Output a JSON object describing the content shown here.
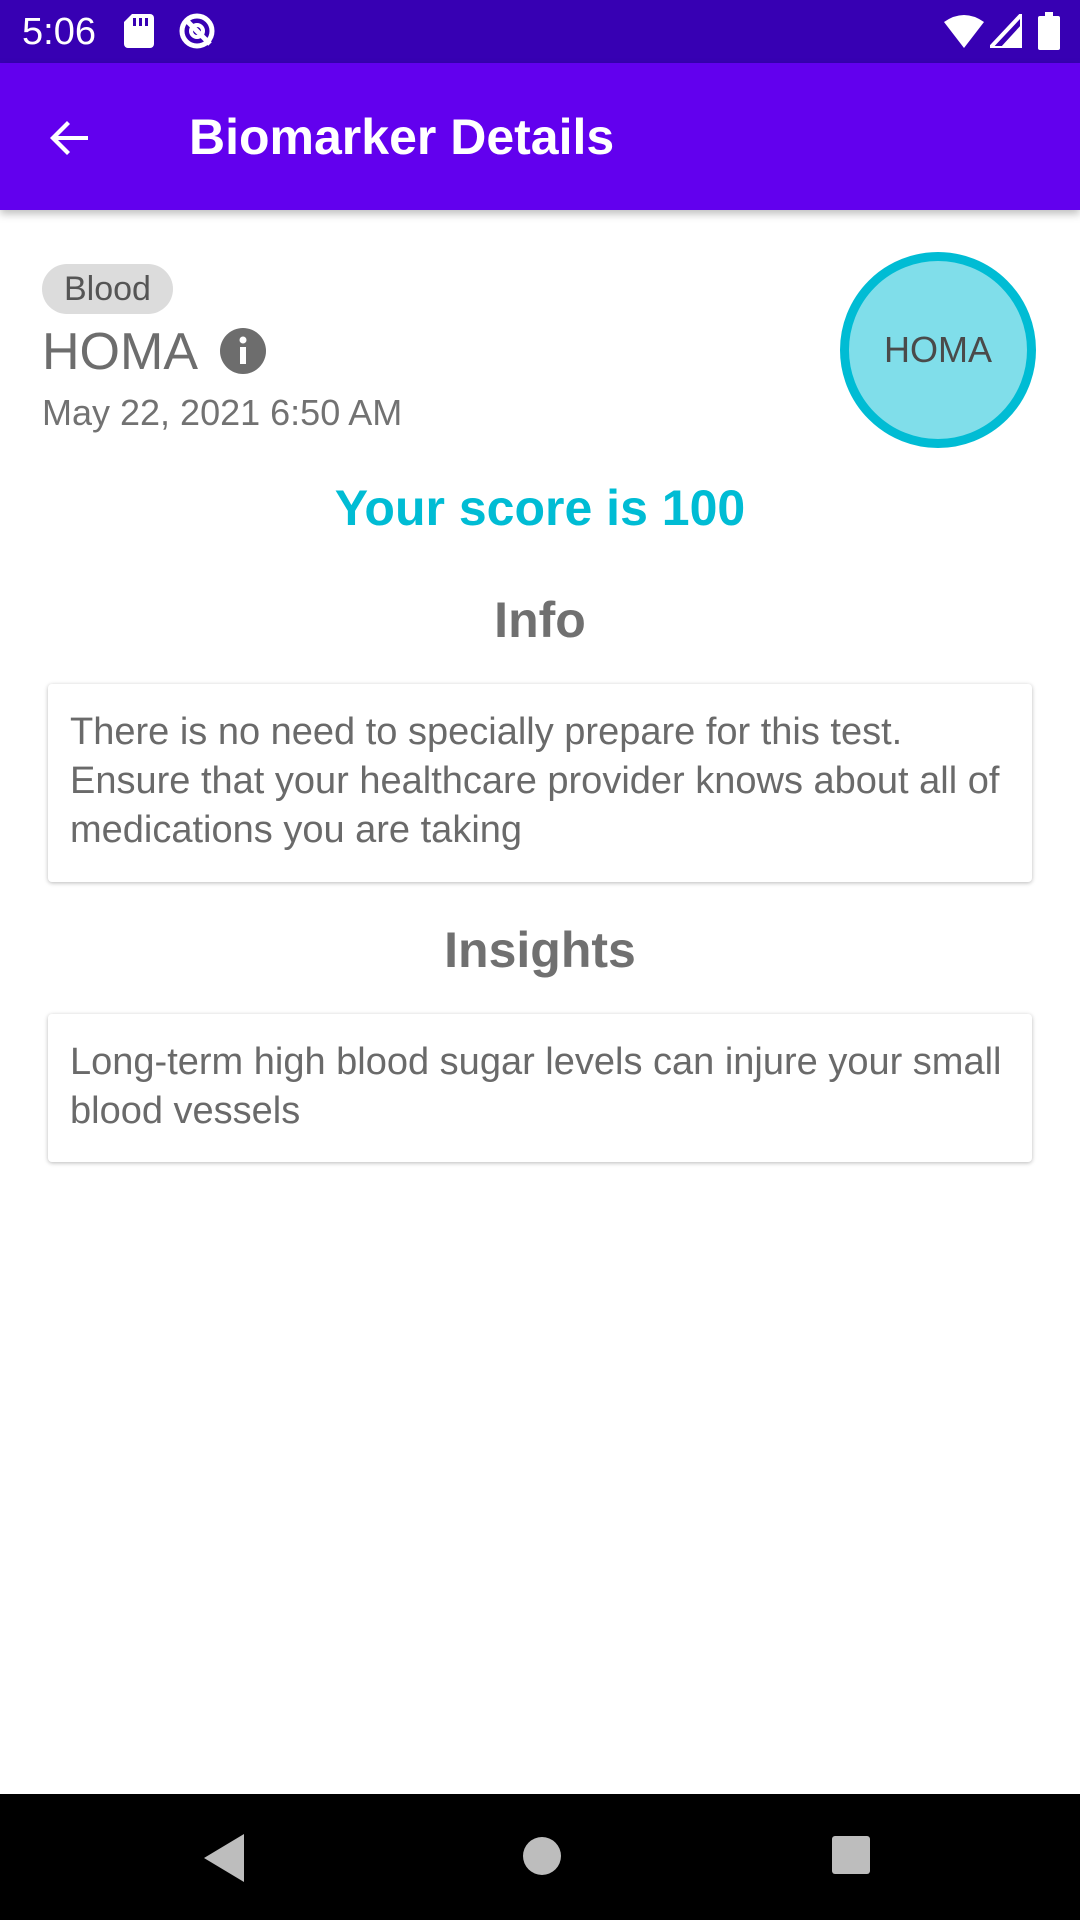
{
  "status_bar": {
    "time": "5:06",
    "icons": [
      "sd-card-icon",
      "vpn-icon",
      "wifi-icon",
      "signal-icon",
      "battery-icon"
    ]
  },
  "app_bar": {
    "title": "Biomarker Details",
    "back_icon": "arrow-back-icon"
  },
  "biomarker": {
    "category": "Blood",
    "name": "HOMA",
    "date": "May 22, 2021 6:50 AM",
    "badge_label": "HOMA",
    "score_text": "Your score is 100"
  },
  "sections": {
    "info_heading": "Info",
    "info_text": "There is no need to specially prepare for this test. Ensure that your healthcare provider knows about all of medications you are taking",
    "insights_heading": "Insights",
    "insights_text": "Long-term high blood sugar levels can injure your small blood vessels"
  },
  "colors": {
    "status_bar": "#3700b3",
    "app_bar": "#6200ee",
    "accent": "#00bcd4",
    "badge_fill": "#80deea"
  }
}
